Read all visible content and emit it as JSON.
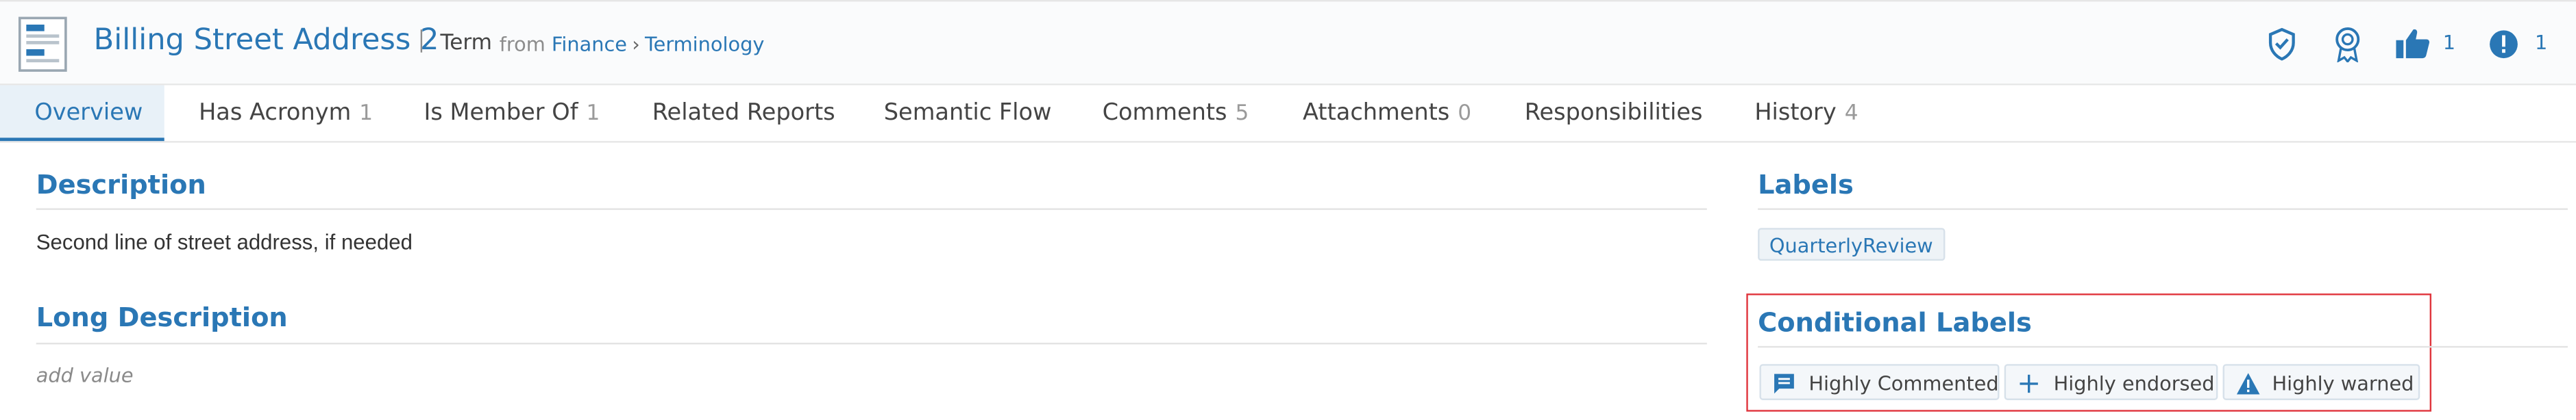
{
  "header": {
    "title": "Billing Street Address 2",
    "type": "Term",
    "from_label": "from",
    "breadcrumb": [
      "Finance",
      "Terminology"
    ],
    "endorse_count": "1",
    "warning_count": "1",
    "icons": [
      "term-document-icon",
      "shield-check-icon",
      "award-ribbon-icon",
      "thumbs-up-icon",
      "warning-circle-icon"
    ]
  },
  "tabs": [
    {
      "label": "Overview",
      "count": ""
    },
    {
      "label": "Has Acronym",
      "count": "1"
    },
    {
      "label": "Is Member Of",
      "count": "1"
    },
    {
      "label": "Related Reports",
      "count": ""
    },
    {
      "label": "Semantic Flow",
      "count": ""
    },
    {
      "label": "Comments",
      "count": "5"
    },
    {
      "label": "Attachments",
      "count": "0"
    },
    {
      "label": "Responsibilities",
      "count": ""
    },
    {
      "label": "History",
      "count": "4"
    }
  ],
  "description": {
    "heading": "Description",
    "value": "Second line of street address, if needed"
  },
  "long_description": {
    "heading": "Long Description",
    "placeholder": "add value"
  },
  "labels": {
    "heading": "Labels",
    "items": [
      "QuarterlyReview"
    ]
  },
  "conditional_labels": {
    "heading": "Conditional Labels",
    "items": [
      {
        "label": "Highly Commented",
        "icon": "comment-icon"
      },
      {
        "label": "Highly endorsed",
        "icon": "plus-icon"
      },
      {
        "label": "Highly warned",
        "icon": "warning-triangle-icon"
      }
    ]
  },
  "colors": {
    "accent": "#2a77b5",
    "highlight_border": "#e0343c"
  }
}
